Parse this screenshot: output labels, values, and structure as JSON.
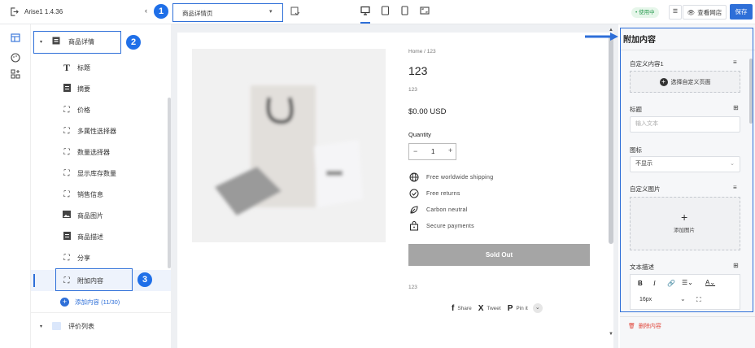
{
  "topbar": {
    "app_name": "Arise1 1.4.36",
    "page_select": "商品详情页",
    "badge": "• 使用中",
    "view_store": "查看网店",
    "save": "保存"
  },
  "callouts": [
    "1",
    "2",
    "3"
  ],
  "tree": {
    "group1": "商品详情",
    "items": [
      "标题",
      "摘要",
      "价格",
      "多属性选择器",
      "数量选择器",
      "显示库存数量",
      "销售信息",
      "商品图片",
      "商品描述",
      "分享",
      "附加内容"
    ],
    "add_content": "添加内容 (11/30)",
    "group2": "评价列表"
  },
  "product": {
    "breadcrumb": "Home / 123",
    "title": "123",
    "sku": "123",
    "price": "$0.00 USD",
    "quantity_label": "Quantity",
    "qty_minus": "−",
    "qty_value": "1",
    "qty_plus": "+",
    "features": [
      "Free worldwide shipping",
      "Free returns",
      "Carbon neutral",
      "Secure payments"
    ],
    "sold_out": "Sold Out",
    "bottom_text": "123",
    "share": [
      "Share",
      "Tweet",
      "Pin it"
    ]
  },
  "rpanel": {
    "title": "附加内容",
    "custom_label": "自定义内容1",
    "select_page": "选择自定义页面",
    "heading_label": "标题",
    "heading_placeholder": "输入文本",
    "icon_label": "图标",
    "icon_value": "不显示",
    "image_label": "自定义图片",
    "add_image": "添加图片",
    "text_label": "文本描述",
    "font_size": "16px",
    "delete": "删除内容"
  }
}
